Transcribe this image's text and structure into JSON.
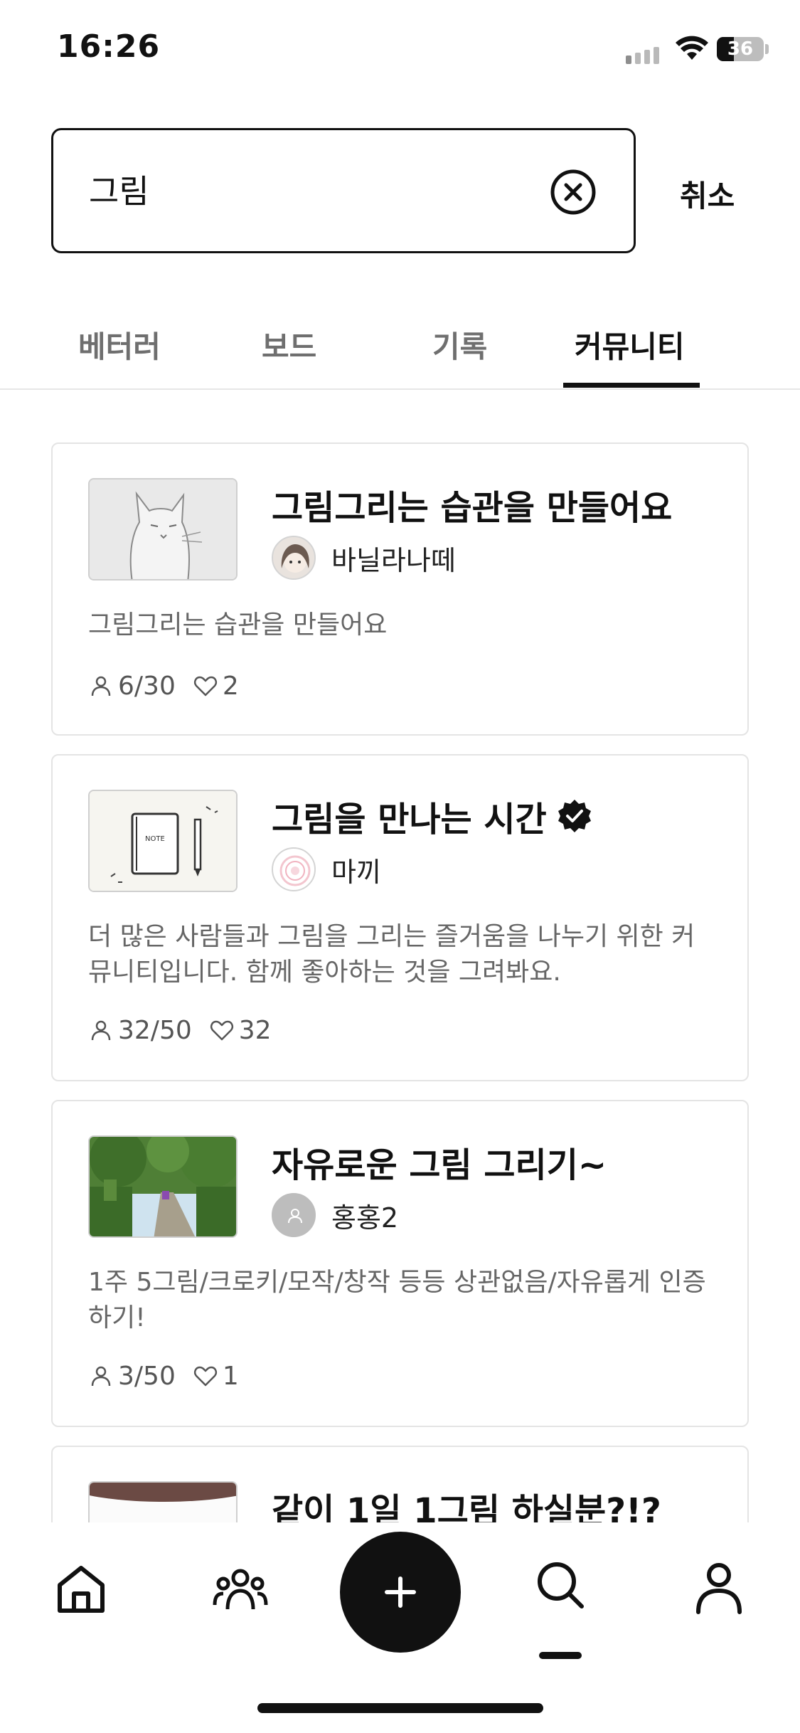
{
  "status_bar": {
    "time": "16:26",
    "battery": "36",
    "battery_level": 0.36
  },
  "search": {
    "query": "그림",
    "cancel_label": "취소"
  },
  "tabs": [
    {
      "label": "베터러"
    },
    {
      "label": "보드"
    },
    {
      "label": "기록"
    },
    {
      "label": "커뮤니티",
      "active": true
    }
  ],
  "communities": [
    {
      "title": "그림그리는 습관을 만들어요",
      "author": "바닐라나떼",
      "description": "그림그리는 습관을 만들어요",
      "members": "6/30",
      "likes": "2"
    },
    {
      "title": "그림을 만나는 시간",
      "verified": true,
      "author": "마끼",
      "description": "더 많은 사람들과 그림을 그리는 즐거움을 나누기 위한 커뮤니티입니다. 함께 좋아하는 것을 그려봐요.",
      "members": "32/50",
      "likes": "32"
    },
    {
      "title": "자유로운 그림 그리기~",
      "author": "홍홍2",
      "description": "1주 5그림/크로키/모작/창작 등등 상관없음/자유롭게 인증하기!",
      "members": "3/50",
      "likes": "1"
    },
    {
      "title": "같이 1일 1그림 하실분?!?"
    }
  ],
  "bottom_nav": {
    "items": [
      "home-icon",
      "community-icon",
      "add-icon",
      "search-icon",
      "profile-icon"
    ],
    "active": "search-icon"
  },
  "colors": {
    "text": "#111111",
    "muted": "#666666",
    "border": "#e4e4e4",
    "accent": "#111111"
  }
}
